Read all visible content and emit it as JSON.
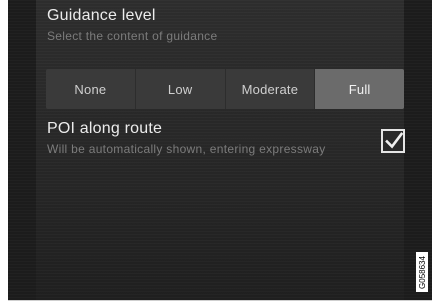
{
  "guidance": {
    "title": "Guidance level",
    "subtitle": "Select the content of guidance",
    "options": [
      "None",
      "Low",
      "Moderate",
      "Full"
    ],
    "selected": "Full"
  },
  "poi": {
    "title": "POI along route",
    "subtitle": "Will be automatically shown, entering expressway",
    "checked": true
  },
  "image_code": "G058634",
  "colors": {
    "background": "#262626",
    "selected_segment": "#6b6b6b",
    "segment": "#3a3a3a",
    "primary_text": "#ececec",
    "secondary_text": "#7c7c7c"
  }
}
